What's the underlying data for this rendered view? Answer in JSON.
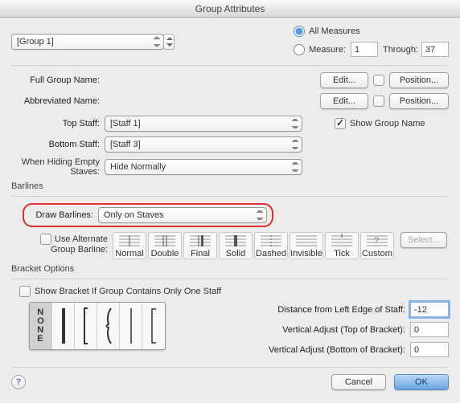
{
  "title": "Group Attributes",
  "group_select": "[Group 1]",
  "measure_mode": {
    "all_label": "All Measures",
    "measure_label": "Measure:",
    "measure_value": "1",
    "through_label": "Through:",
    "through_value": "37",
    "selected": "all"
  },
  "rows": {
    "full_group_name": "Full Group Name:",
    "abbrev_name": "Abbreviated Name:",
    "top_staff": "Top Staff:",
    "top_staff_val": "[Staff 1]",
    "bottom_staff": "Bottom Staff:",
    "bottom_staff_val": "[Staff 3]",
    "when_hiding": "When Hiding Empty Staves:",
    "when_hiding_val": "Hide Normally",
    "edit_btn": "Edit...",
    "position_btn": "Position...",
    "show_group_name": "Show Group Name"
  },
  "barlines": {
    "header": "Barlines",
    "draw_label": "Draw Barlines:",
    "draw_value": "Only on Staves",
    "use_alt": "Use Alternate Group Barline:",
    "opts": [
      "Normal",
      "Double",
      "Final",
      "Solid",
      "Dashed",
      "Invisible",
      "Tick",
      "Custom"
    ],
    "select_btn": "Select..."
  },
  "bracket": {
    "header": "Bracket Options",
    "show_one": "Show Bracket If Group Contains Only One Staff",
    "dist_label": "Distance from Left Edge of Staff:",
    "dist_value": "-12",
    "vtop_label": "Vertical Adjust (Top of Bracket):",
    "vtop_value": "0",
    "vbot_label": "Vertical Adjust (Bottom of Bracket):",
    "vbot_value": "0"
  },
  "footer": {
    "cancel": "Cancel",
    "ok": "OK",
    "help": "?"
  }
}
